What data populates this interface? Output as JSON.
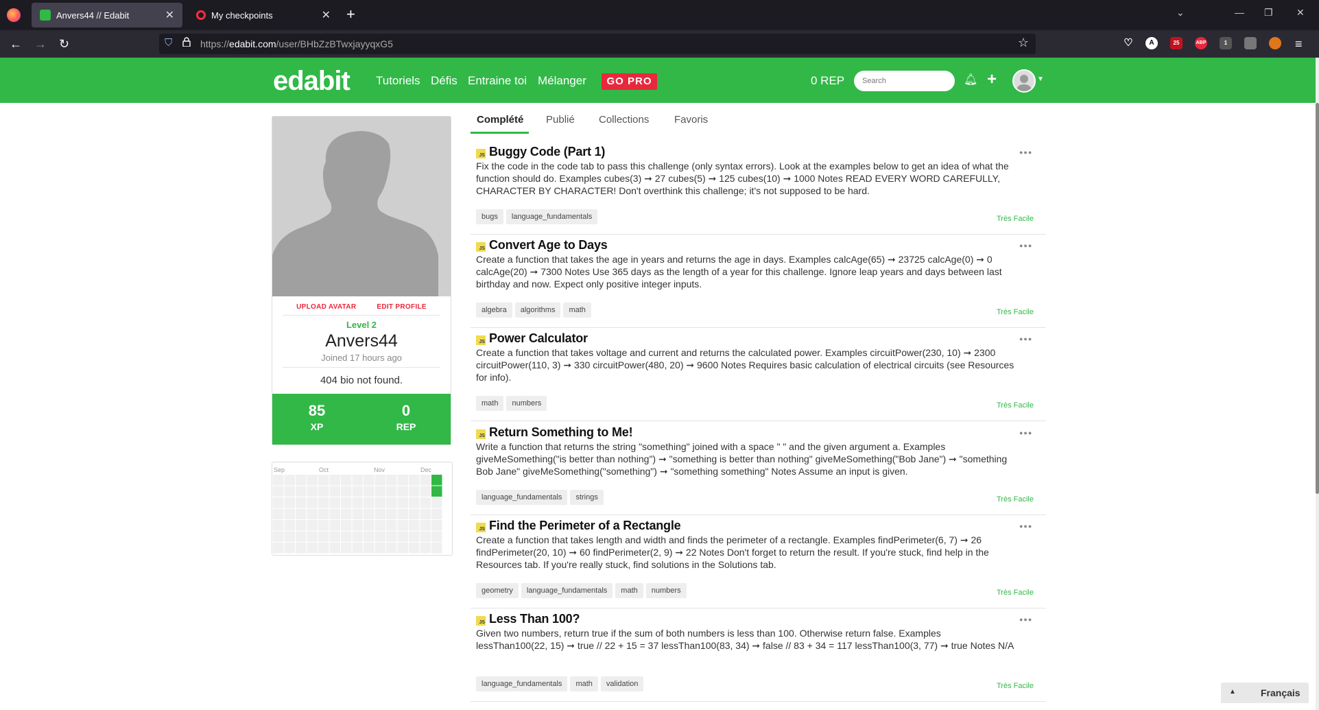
{
  "browser": {
    "tabs": [
      {
        "title": "Anvers44 // Edabit",
        "active": true
      },
      {
        "title": "My checkpoints",
        "active": false
      }
    ],
    "url_prefix": "https://",
    "url_domain": "edabit.com",
    "url_path": "/user/BHbZzBTwxjayyqxG5",
    "extension_badges": {
      "ublock": "25",
      "abp": "ABP",
      "ext3": "1"
    }
  },
  "header": {
    "logo": "edabit",
    "nav": [
      "Tutoriels",
      "Défis",
      "Entraine toi",
      "Mélanger"
    ],
    "gopro": "GO PRO",
    "rep": "0 REP",
    "search_placeholder": "Search"
  },
  "profile": {
    "upload_avatar": "UPLOAD AVATAR",
    "edit_profile": "EDIT PROFILE",
    "level": "Level 2",
    "username": "Anvers44",
    "joined": "Joined 17 hours ago",
    "bio": "404 bio not found.",
    "xp_value": "85",
    "xp_label": "XP",
    "rep_value": "0",
    "rep_label": "REP"
  },
  "heatmap": {
    "months": [
      "Sep",
      "Oct",
      "Nov",
      "Dec"
    ],
    "active_days": 2
  },
  "profile_tabs": [
    "Complété",
    "Publié",
    "Collections",
    "Favoris"
  ],
  "challenges": [
    {
      "lang": "JS",
      "title": "Buggy Code (Part 1)",
      "desc": "Fix the code in the code tab to pass this challenge (only syntax errors). Look at the examples below to get an idea of what the function should do. Examples cubes(3) ➞ 27 cubes(5) ➞ 125 cubes(10) ➞ 1000 Notes READ EVERY WORD CAREFULLY, CHARACTER BY CHARACTER! Don't overthink this challenge; it's not supposed to be hard.",
      "tags": [
        "bugs",
        "language_fundamentals"
      ],
      "difficulty": "Très Facile"
    },
    {
      "lang": "JS",
      "title": "Convert Age to Days",
      "desc": "Create a function that takes the age in years and returns the age in days. Examples calcAge(65) ➞ 23725 calcAge(0) ➞ 0 calcAge(20) ➞ 7300 Notes Use 365 days as the length of a year for this challenge. Ignore leap years and days between last birthday and now. Expect only positive integer inputs.",
      "tags": [
        "algebra",
        "algorithms",
        "math"
      ],
      "difficulty": "Très Facile"
    },
    {
      "lang": "JS",
      "title": "Power Calculator",
      "desc": "Create a function that takes voltage and current and returns the calculated power. Examples circuitPower(230, 10) ➞ 2300 circuitPower(110, 3) ➞ 330 circuitPower(480, 20) ➞ 9600 Notes Requires basic calculation of electrical circuits (see Resources for info).",
      "tags": [
        "math",
        "numbers"
      ],
      "difficulty": "Très Facile"
    },
    {
      "lang": "JS",
      "title": "Return Something to Me!",
      "desc": "Write a function that returns the string \"something\" joined with a space \" \" and the given argument a. Examples giveMeSomething(\"is better than nothing\") ➞ \"something is better than nothing\" giveMeSomething(\"Bob Jane\") ➞ \"something Bob Jane\" giveMeSomething(\"something\") ➞ \"something something\" Notes Assume an input is given.",
      "tags": [
        "language_fundamentals",
        "strings"
      ],
      "difficulty": "Très Facile"
    },
    {
      "lang": "JS",
      "title": "Find the Perimeter of a Rectangle",
      "desc": "Create a function that takes length and width and finds the perimeter of a rectangle. Examples findPerimeter(6, 7) ➞ 26 findPerimeter(20, 10) ➞ 60 findPerimeter(2, 9) ➞ 22 Notes Don't forget to return the result. If you're stuck, find help in the Resources tab. If you're really stuck, find solutions in the Solutions tab.",
      "tags": [
        "geometry",
        "language_fundamentals",
        "math",
        "numbers"
      ],
      "difficulty": "Très Facile"
    },
    {
      "lang": "JS",
      "title": "Less Than 100?",
      "desc": "Given two numbers, return true if the sum of both numbers is less than 100. Otherwise return false. Examples lessThan100(22, 15) ➞ true // 22 + 15 = 37 lessThan100(83, 34) ➞ false // 83 + 34 = 117 lessThan100(3, 77) ➞ true Notes N/A",
      "tags": [
        "language_fundamentals",
        "math",
        "validation"
      ],
      "difficulty": "Très Facile"
    }
  ],
  "language_selector": "Français",
  "colors": {
    "brand_green": "#31b847",
    "accent_red": "#e8283c"
  }
}
